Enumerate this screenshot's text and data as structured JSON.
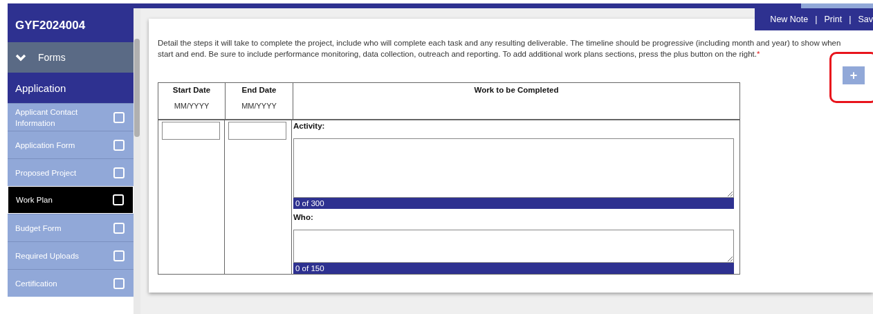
{
  "sidebar": {
    "title": "GYF2024004",
    "section": {
      "label": "Forms",
      "expanded": true
    },
    "group": "Application",
    "items": [
      {
        "label": "Applicant Contact Information",
        "selected": false,
        "checked": false
      },
      {
        "label": "Application Form",
        "selected": false,
        "checked": false
      },
      {
        "label": "Proposed Project",
        "selected": false,
        "checked": false
      },
      {
        "label": "Work Plan",
        "selected": true,
        "checked": false
      },
      {
        "label": "Budget Form",
        "selected": false,
        "checked": false
      },
      {
        "label": "Required Uploads",
        "selected": false,
        "checked": false
      },
      {
        "label": "Certification",
        "selected": false,
        "checked": false
      }
    ]
  },
  "actions": {
    "items": [
      "New Note",
      "Print",
      "Sav"
    ],
    "separator": "|"
  },
  "description": {
    "lines": [
      "Detail the steps it will take to complete the project, include who will complete each task and any resulting deliverable. The timeline should be progressive (including month and year) to show when",
      "start and end.  Be sure to include performance monitoring, data collection, outreach and reporting. To add additional work plans sections, press the plus button on the right."
    ],
    "required_mark": "*"
  },
  "add_button": {
    "label": "+",
    "highlighted": true
  },
  "table": {
    "columns": [
      {
        "heading": "Start Date",
        "hint": "MM/YYYY"
      },
      {
        "heading": "End Date",
        "hint": "MM/YYYY"
      },
      {
        "heading": "Work to be Completed"
      }
    ],
    "fields": [
      {
        "label": "Activity:",
        "counter": "0 of 300",
        "kind": "tall"
      },
      {
        "label": "Who:",
        "counter": "0 of 150",
        "kind": "short"
      }
    ]
  }
}
